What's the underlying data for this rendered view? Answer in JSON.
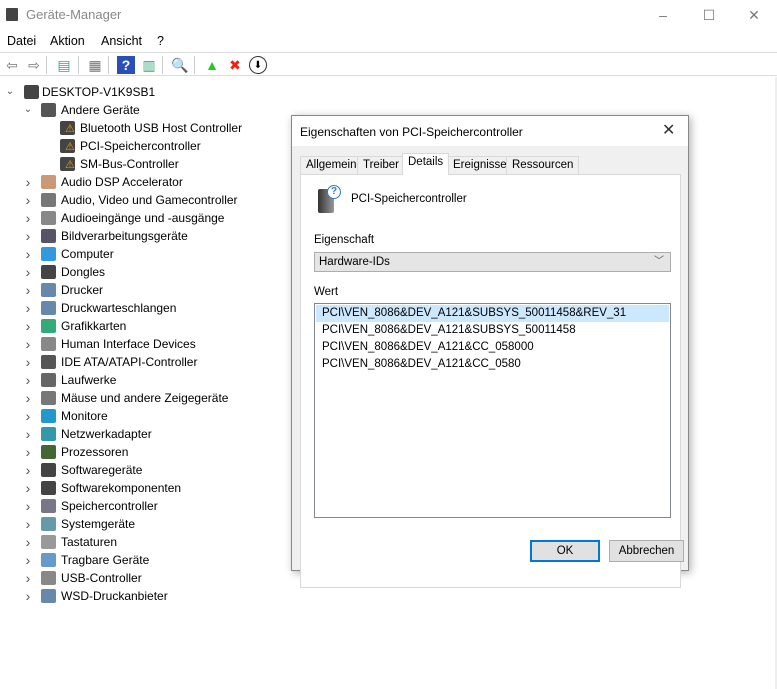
{
  "window": {
    "title": "Geräte-Manager",
    "minimize": "–",
    "maximize": "☐",
    "close": "✕"
  },
  "menu": [
    "Datei",
    "Aktion",
    "Ansicht",
    "?"
  ],
  "toolbar": [
    {
      "name": "back-icon",
      "glyph": "⇦",
      "color": "#777"
    },
    {
      "name": "forward-icon",
      "glyph": "⇨",
      "color": "#777"
    },
    {
      "name": "show-hide-console-tree-icon",
      "glyph": "▤",
      "color": "#3a7"
    },
    {
      "name": "properties-icon",
      "glyph": "▦",
      "color": "#777"
    },
    {
      "name": "help-icon",
      "glyph": "?",
      "color": "#fff"
    },
    {
      "name": "action-pane-icon",
      "glyph": "▥",
      "color": "#3a7"
    },
    {
      "name": "scan-hardware-icon",
      "glyph": "🔍",
      "color": "#2a7ad5"
    },
    {
      "name": "update-driver-icon",
      "glyph": "▲",
      "color": "#2c2"
    },
    {
      "name": "uninstall-icon",
      "glyph": "✖",
      "color": "#e21"
    },
    {
      "name": "disable-device-icon",
      "glyph": "⬇",
      "color": "#000"
    }
  ],
  "tree": {
    "root": "DESKTOP-V1K9SB1",
    "other": {
      "label": "Andere Geräte",
      "children": [
        "Bluetooth USB Host Controller",
        "PCI-Speichercontroller",
        "SM-Bus-Controller"
      ]
    },
    "categories": [
      "Audio DSP Accelerator",
      "Audio, Video und Gamecontroller",
      "Audioeingänge und -ausgänge",
      "Bildverarbeitungsgeräte",
      "Computer",
      "Dongles",
      "Drucker",
      "Druckwarteschlangen",
      "Grafikkarten",
      "Human Interface Devices",
      "IDE ATA/ATAPI-Controller",
      "Laufwerke",
      "Mäuse und andere Zeigegeräte",
      "Monitore",
      "Netzwerkadapter",
      "Prozessoren",
      "Softwaregeräte",
      "Softwarekomponenten",
      "Speichercontroller",
      "Systemgeräte",
      "Tastaturen",
      "Tragbare Geräte",
      "USB-Controller",
      "WSD-Druckanbieter"
    ]
  },
  "dialog": {
    "title": "Eigenschaften von PCI-Speichercontroller",
    "close": "✕",
    "tabs": [
      "Allgemein",
      "Treiber",
      "Details",
      "Ereignisse",
      "Ressourcen"
    ],
    "active_tab": "Details",
    "device_name": "PCI-Speichercontroller",
    "property_label": "Eigenschaft",
    "property_value": "Hardware-IDs",
    "value_label": "Wert",
    "values": [
      "PCI\\VEN_8086&DEV_A121&SUBSYS_50011458&REV_31",
      "PCI\\VEN_8086&DEV_A121&SUBSYS_50011458",
      "PCI\\VEN_8086&DEV_A121&CC_058000",
      "PCI\\VEN_8086&DEV_A121&CC_0580"
    ],
    "ok": "OK",
    "cancel": "Abbrechen"
  }
}
